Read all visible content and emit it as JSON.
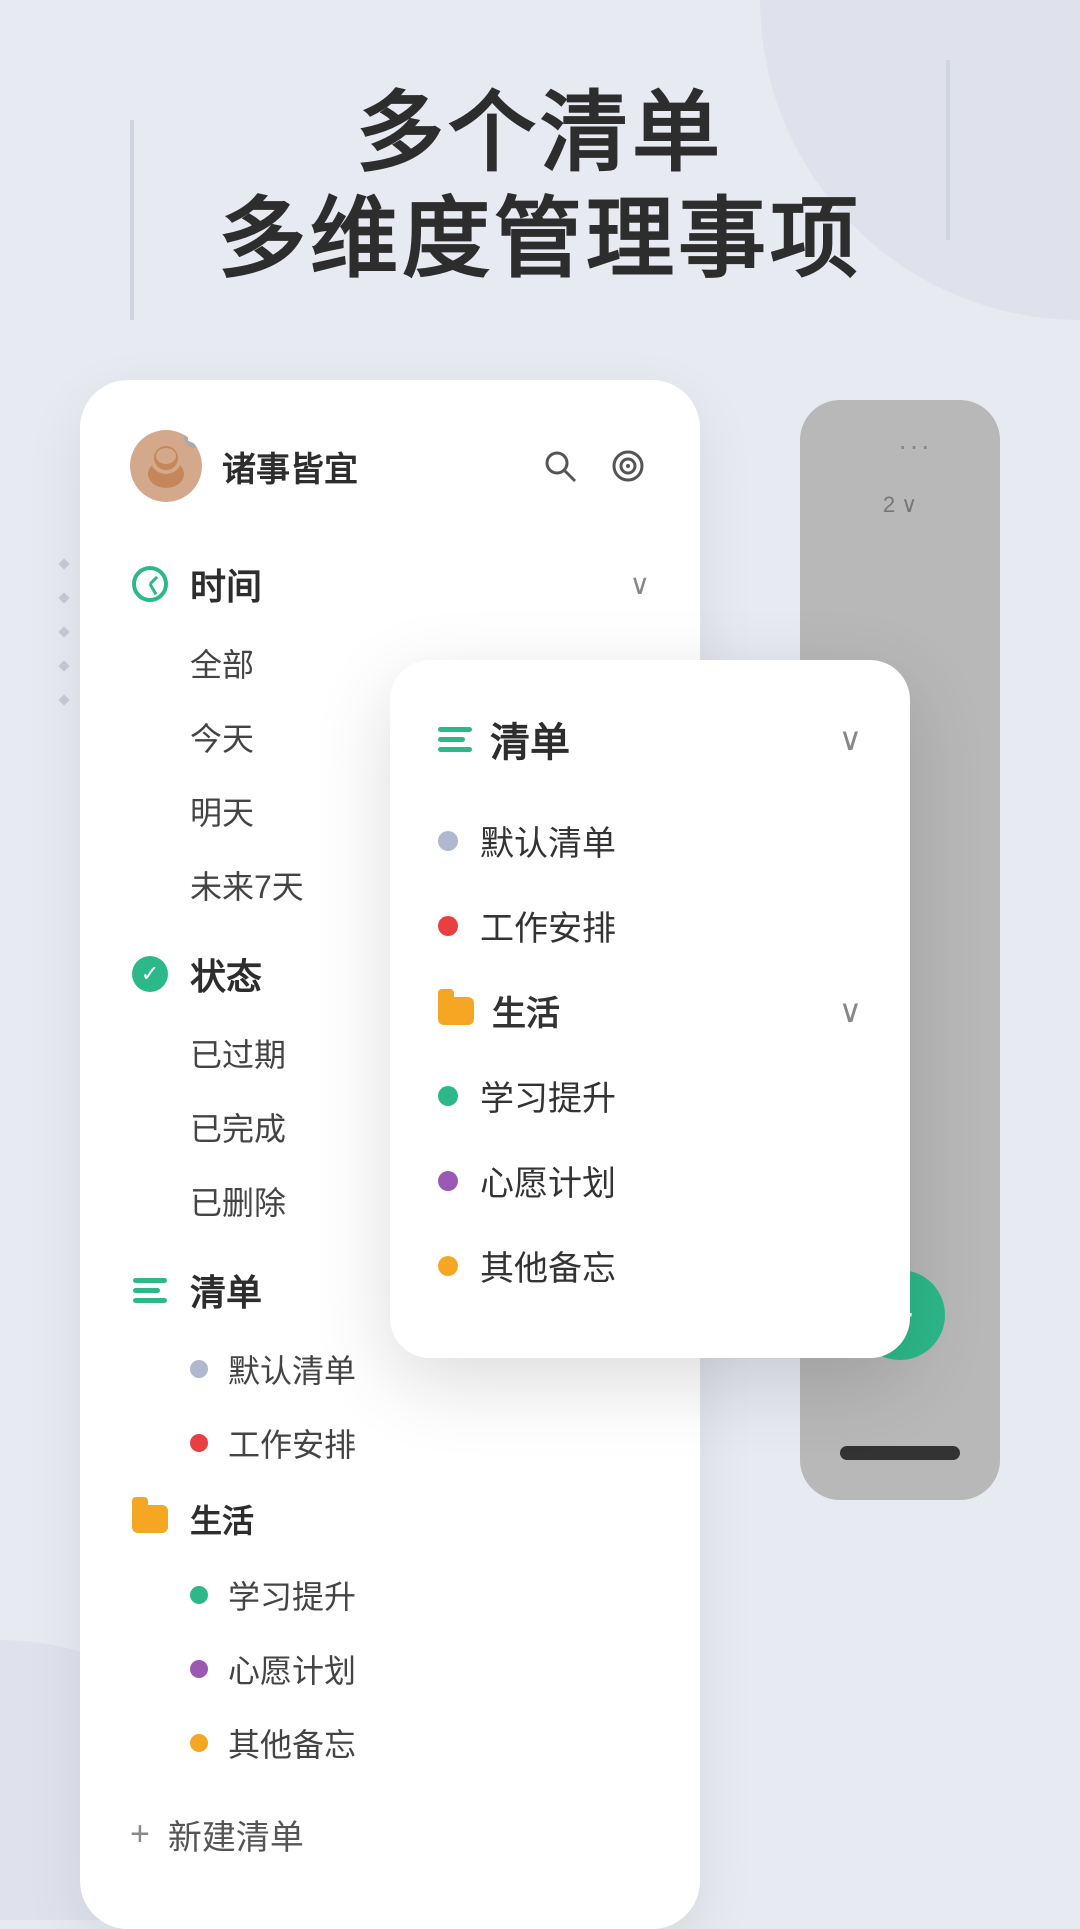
{
  "header": {
    "line1": "多个清单",
    "line2": "多维度管理事项"
  },
  "user": {
    "name": "诸事皆宜",
    "avatar_emoji": "👩"
  },
  "sidebar": {
    "sections": [
      {
        "id": "time",
        "icon": "clock",
        "label": "时间",
        "collapsible": true,
        "items": [
          "全部",
          "今天",
          "明天",
          "未来7天"
        ]
      },
      {
        "id": "status",
        "icon": "checkmark",
        "label": "状态",
        "collapsible": false,
        "items": [
          "已过期",
          "已完成",
          "已删除"
        ]
      },
      {
        "id": "list",
        "icon": "list",
        "label": "清单",
        "collapsible": false,
        "items": []
      }
    ],
    "list_items": [
      {
        "label": "默认清单",
        "color": "#b0b8d0"
      },
      {
        "label": "工作安排",
        "color": "#e84040"
      }
    ],
    "folder": {
      "label": "生活",
      "items": [
        {
          "label": "学习提升",
          "color": "#2db88a"
        },
        {
          "label": "心愿计划",
          "color": "#9b59b6"
        },
        {
          "label": "其他备忘",
          "color": "#f5a623"
        }
      ]
    },
    "new_list_label": "新建清单"
  },
  "overlay": {
    "section_label": "清单",
    "items": [
      {
        "label": "默认清单",
        "color": "#b0b8d0"
      },
      {
        "label": "工作安排",
        "color": "#e84040"
      }
    ],
    "folder": {
      "label": "生活",
      "items": [
        {
          "label": "学习提升",
          "color": "#2db88a"
        },
        {
          "label": "心愿计划",
          "color": "#9b59b6"
        },
        {
          "label": "其他备忘",
          "color": "#f5a623"
        }
      ]
    }
  },
  "back_panel": {
    "badge_count": "2",
    "fab_label": "+"
  },
  "colors": {
    "green": "#2db88a",
    "red": "#e84040",
    "purple": "#9b59b6",
    "orange": "#f5a623",
    "gray_dot": "#b0b8d0",
    "teal": "#2db88a"
  }
}
